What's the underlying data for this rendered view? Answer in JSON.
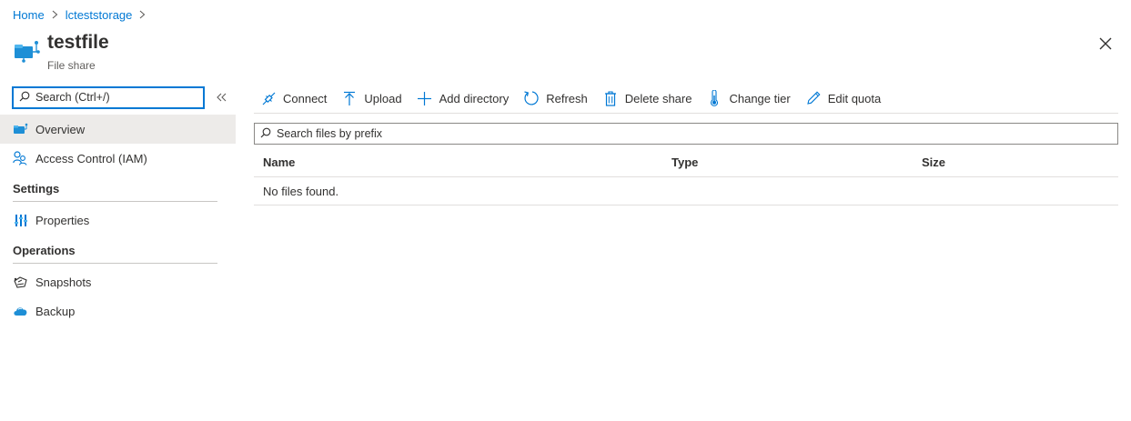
{
  "breadcrumb": {
    "items": [
      "Home",
      "lcteststorage"
    ]
  },
  "header": {
    "title": "testfile",
    "subtitle": "File share",
    "icon": "file-share-icon"
  },
  "sidebar": {
    "search_placeholder": "Search (Ctrl+/)",
    "items": [
      {
        "label": "Overview",
        "icon": "file-share-icon",
        "active": true
      },
      {
        "label": "Access Control (IAM)",
        "icon": "people-icon"
      }
    ],
    "sections": [
      {
        "title": "Settings",
        "items": [
          {
            "label": "Properties",
            "icon": "properties-icon"
          }
        ]
      },
      {
        "title": "Operations",
        "items": [
          {
            "label": "Snapshots",
            "icon": "snapshots-icon"
          },
          {
            "label": "Backup",
            "icon": "backup-cloud-icon"
          }
        ]
      }
    ]
  },
  "toolbar": {
    "buttons": [
      {
        "label": "Connect",
        "icon": "connect-icon"
      },
      {
        "label": "Upload",
        "icon": "upload-icon"
      },
      {
        "label": "Add directory",
        "icon": "plus-icon"
      },
      {
        "label": "Refresh",
        "icon": "refresh-icon"
      },
      {
        "label": "Delete share",
        "icon": "trash-icon"
      },
      {
        "label": "Change tier",
        "icon": "thermometer-icon"
      },
      {
        "label": "Edit quota",
        "icon": "pencil-icon"
      }
    ]
  },
  "content": {
    "search_placeholder": "Search files by prefix",
    "columns": [
      "Name",
      "Type",
      "Size"
    ],
    "empty_message": "No files found."
  },
  "colors": {
    "accent": "#0078d4",
    "active_bg": "#edebe9",
    "text": "#323130"
  }
}
